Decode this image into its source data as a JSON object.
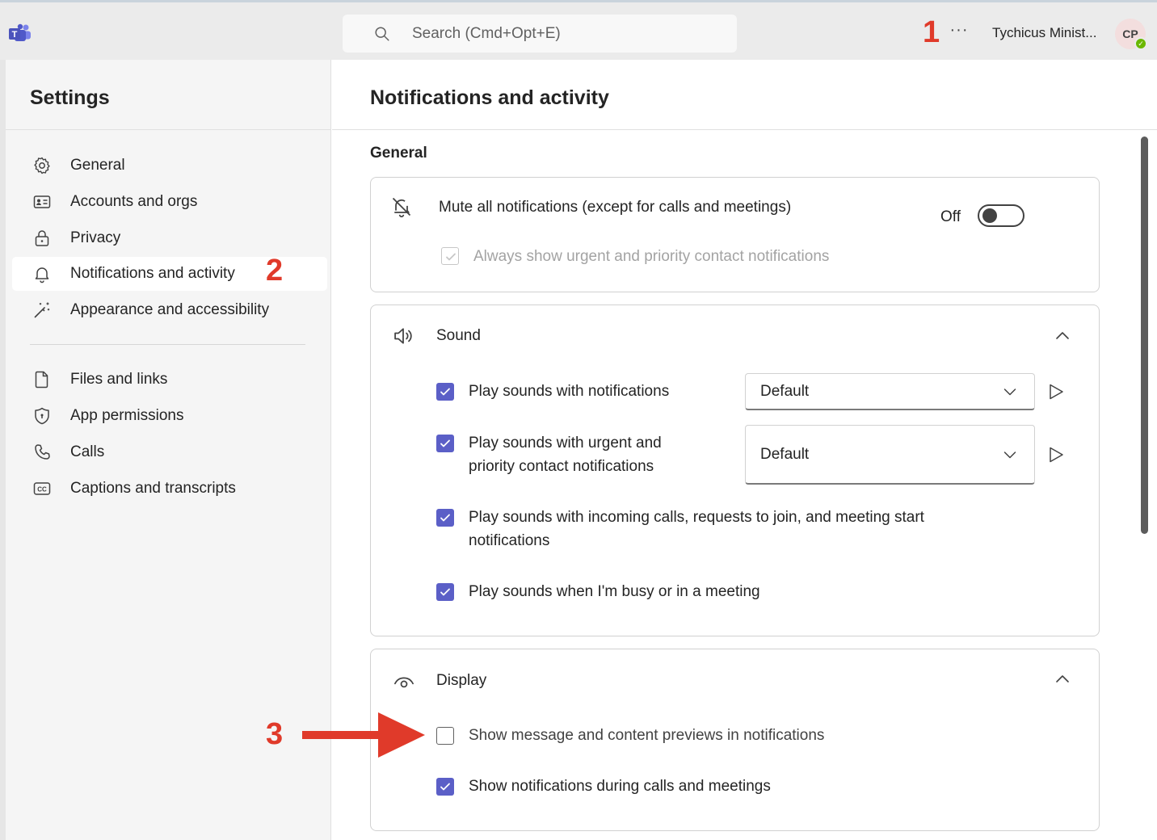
{
  "topbar": {
    "search_placeholder": "Search (Cmd+Opt+E)",
    "more_label": "···",
    "user_name": "Tychicus Minist...",
    "avatar_initials": "CP",
    "presence_status": "available"
  },
  "annotations": {
    "one": "1",
    "two": "2",
    "three": "3",
    "color": "#e03a2a"
  },
  "sidebar": {
    "title": "Settings",
    "items": [
      {
        "label": "General",
        "icon": "gear-icon"
      },
      {
        "label": "Accounts and orgs",
        "icon": "contact-card-icon"
      },
      {
        "label": "Privacy",
        "icon": "lock-icon"
      },
      {
        "label": "Notifications and activity",
        "icon": "bell-icon",
        "active": true
      },
      {
        "label": "Appearance and accessibility",
        "icon": "magic-wand-icon"
      },
      {
        "label": "Files and links",
        "icon": "document-icon"
      },
      {
        "label": "App permissions",
        "icon": "shield-icon"
      },
      {
        "label": "Calls",
        "icon": "phone-icon"
      },
      {
        "label": "Captions and transcripts",
        "icon": "closed-captions-icon"
      }
    ]
  },
  "main": {
    "title": "Notifications and activity",
    "section_general": "General",
    "mute_card": {
      "label": "Mute all notifications (except for calls and meetings)",
      "toggle_state": "Off",
      "urgent_label": "Always show urgent and priority contact notifications",
      "urgent_checked": true,
      "urgent_disabled": true
    },
    "sound_card": {
      "title": "Sound",
      "options": [
        {
          "label": "Play sounds with notifications",
          "checked": true,
          "select": "Default"
        },
        {
          "label_line1": "Play sounds with urgent and",
          "label_line2": "priority contact notifications",
          "checked": true,
          "select": "Default"
        },
        {
          "label_line1": "Play sounds with incoming calls, requests to join, and meeting start",
          "label_line2": "notifications",
          "checked": true
        },
        {
          "label": "Play sounds when I'm busy or in a meeting",
          "checked": true
        }
      ]
    },
    "display_card": {
      "title": "Display",
      "options": [
        {
          "label": "Show message and content previews in notifications",
          "checked": false
        },
        {
          "label": "Show notifications during calls and meetings",
          "checked": true
        }
      ]
    }
  },
  "colors": {
    "accent": "#5b5fc7",
    "topbar_bg": "#ebebeb",
    "sidebar_bg": "#f5f5f5",
    "available": "#6bb700"
  }
}
